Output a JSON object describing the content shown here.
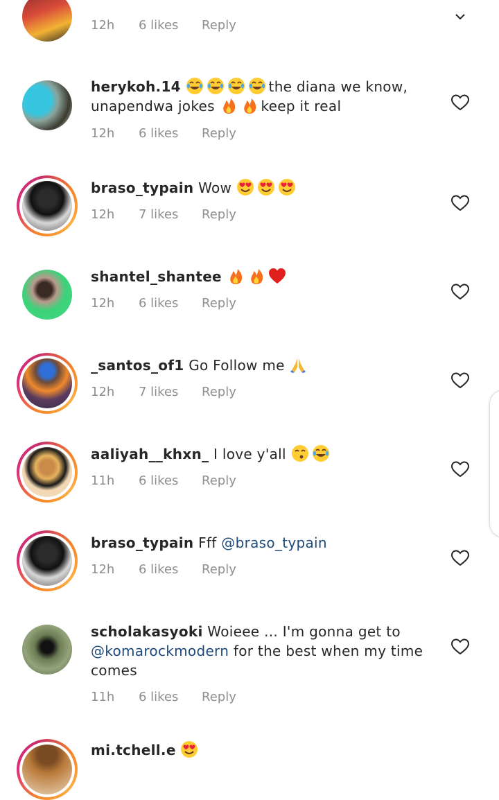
{
  "comments": [
    {
      "user": "",
      "text": "",
      "time": "12h",
      "likes": "6 likes",
      "reply": "Reply"
    },
    {
      "user": "herykoh.14",
      "text": "the diana we know, unapendwa jokes",
      "text_end": "keep it real",
      "time": "12h",
      "likes": "6 likes",
      "reply": "Reply"
    },
    {
      "user": "braso_typain",
      "text": "Wow",
      "time": "12h",
      "likes": "7 likes",
      "reply": "Reply"
    },
    {
      "user": "shantel_shantee",
      "text": "",
      "time": "12h",
      "likes": "6 likes",
      "reply": "Reply"
    },
    {
      "user": "_santos_of1",
      "text": "Go Follow me",
      "time": "12h",
      "likes": "7 likes",
      "reply": "Reply"
    },
    {
      "user": "aaliyah__khxn_",
      "text": "I love y'all",
      "time": "11h",
      "likes": "6 likes",
      "reply": "Reply"
    },
    {
      "user": "braso_typain",
      "text": "Fff",
      "mention": "@braso_typain",
      "time": "12h",
      "likes": "6 likes",
      "reply": "Reply"
    },
    {
      "user": "scholakasyoki",
      "text": "Woieee ... I'm gonna get to",
      "mention": "@komarockmodern",
      "text_end": " for the best when my time comes",
      "time": "11h",
      "likes": "6 likes",
      "reply": "Reply"
    },
    {
      "user": "mi.tchell.e",
      "text": ""
    }
  ],
  "icons": {
    "heart": "heart-outline-icon",
    "chevron": "chevron-down-icon"
  },
  "colors": {
    "meta": "#8e8e8e",
    "mention": "#1f4a7c",
    "text": "#262626",
    "ring_start": "#f58529",
    "ring_end": "#dd2a7b"
  }
}
